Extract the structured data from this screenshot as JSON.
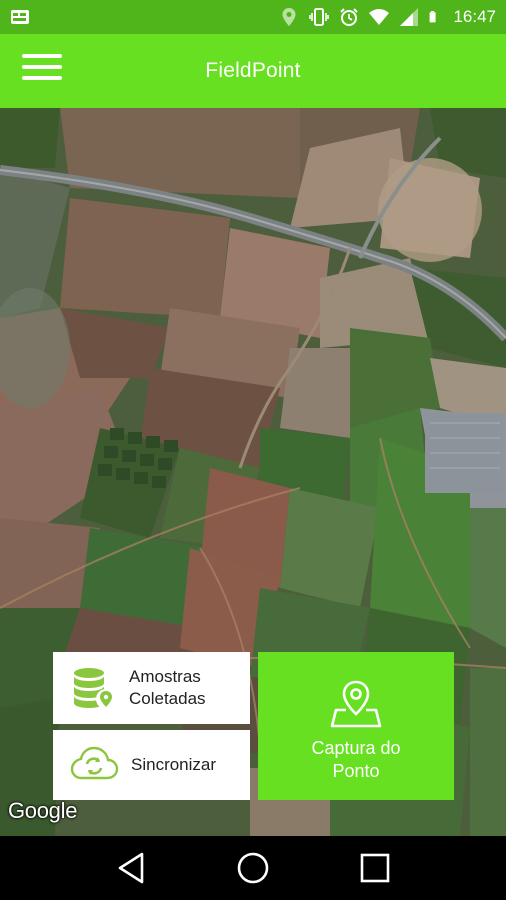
{
  "status_bar": {
    "time": "16:47",
    "icons": [
      "notification-icon",
      "location-icon",
      "vibrate-icon",
      "alarm-icon",
      "wifi-icon",
      "signal-icon",
      "battery-icon"
    ]
  },
  "app_bar": {
    "title": "FieldPoint",
    "menu_icon": "hamburger-menu-icon"
  },
  "map": {
    "attribution": "Google"
  },
  "actions": {
    "samples": {
      "line1": "Amostras",
      "line2": "Coletadas",
      "icon": "database-location-icon"
    },
    "sync": {
      "label": "Sincronizar",
      "icon": "cloud-sync-icon"
    },
    "capture": {
      "line1": "Captura do",
      "line2": "Ponto",
      "icon": "map-pin-icon"
    }
  },
  "navigation": {
    "back": "back-icon",
    "home": "home-icon",
    "recents": "recents-icon"
  },
  "colors": {
    "status_bar": "#4fb51a",
    "primary": "#66e020",
    "icon_green": "#8bc63f"
  }
}
